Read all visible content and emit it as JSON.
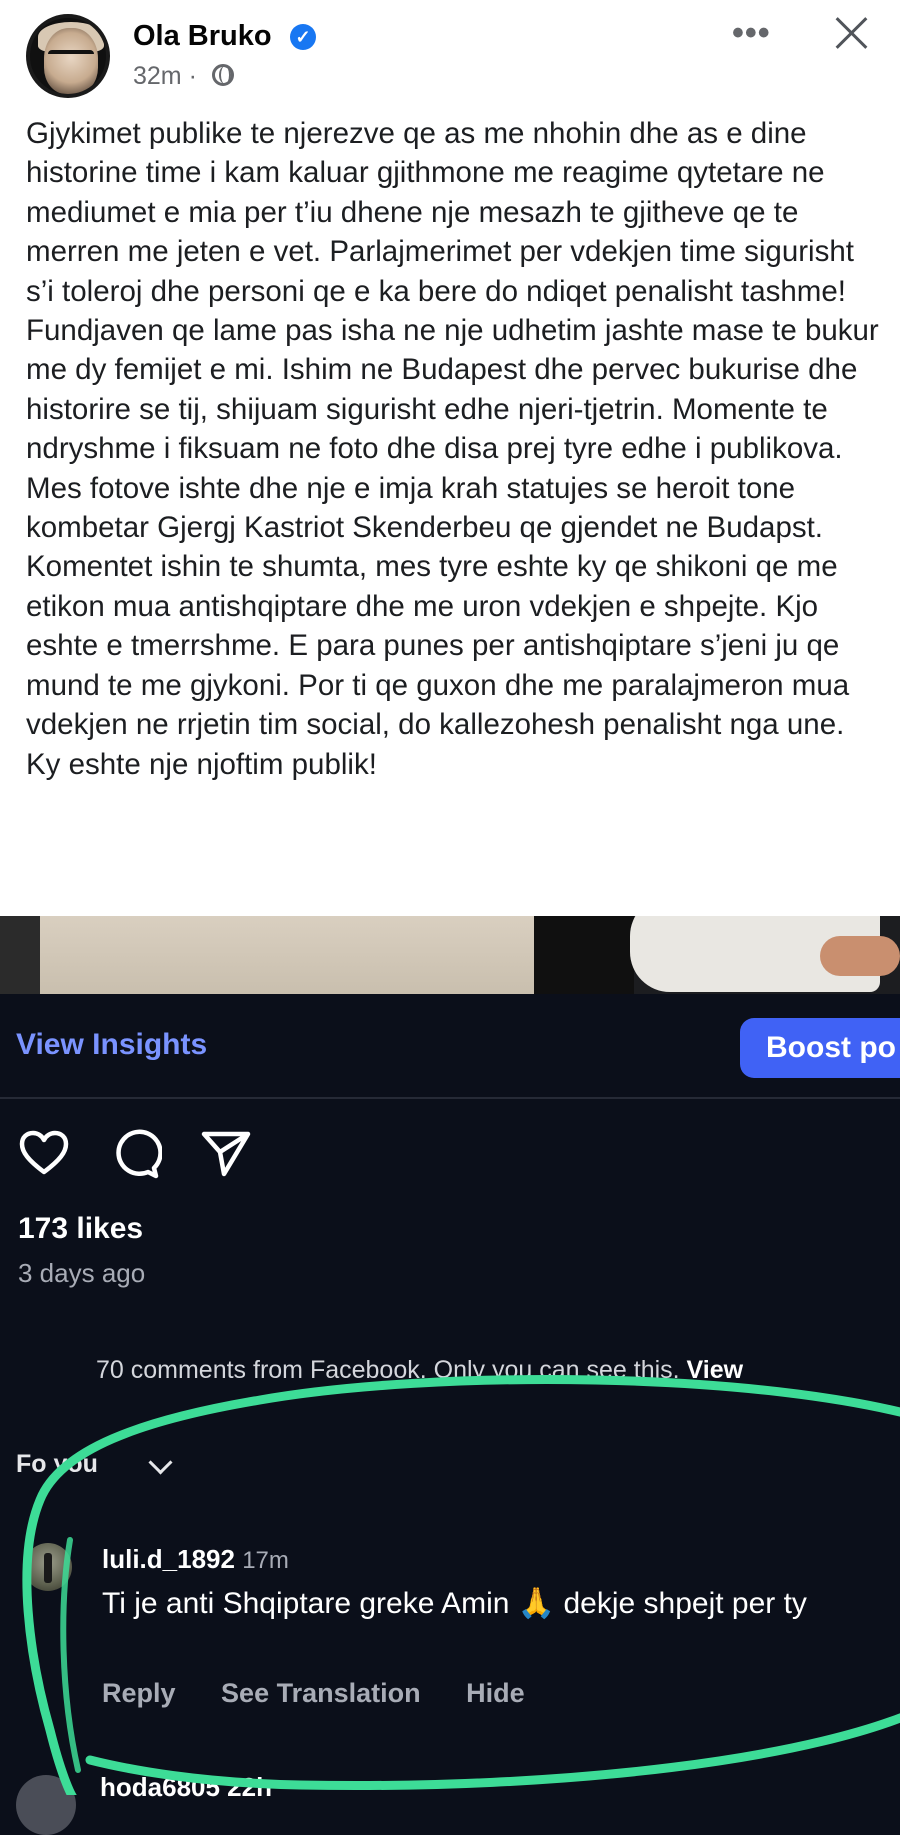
{
  "post": {
    "author": "Ola Bruko",
    "time": "32m ·",
    "text": "Gjykimet publike te njerezve qe as me nhohin dhe as e dine  historine time i kam kaluar gjithmone me reagime qytetare ne mediumet e mia per t’iu dhene nje mesazh te gjitheve qe te merren me jeten e vet. Parlajmerimet per vdekjen time sigurisht s’i toleroj dhe personi qe e ka bere do ndiqet penalisht tashme!\nFundjaven qe lame pas isha ne nje udhetim jashte mase te bukur me dy femijet e mi. Ishim ne Budapest dhe pervec bukurise dhe historire se tij, shijuam sigurisht edhe njeri-tjetrin. Momente te ndryshme i fiksuam ne foto dhe disa prej tyre edhe i publikova. Mes fotove ishte dhe nje e imja krah statujes se heroit tone kombetar Gjergj Kastriot Skenderbeu qe gjendet ne Budapst. Komentet ishin te shumta, mes tyre eshte ky qe shikoni qe me etikon mua antishqiptare dhe me uron vdekjen e shpejte. Kjo eshte e tmerrshme. E para punes per antishqiptare s’jeni ju qe mund te me gjykoni. Por ti qe guxon dhe me paralajmeron mua vdekjen ne rrjetin tim social, do kallezohesh penalisht nga une. Ky eshte nje njoftim publik!",
    "icons": [
      "verified-badge-icon",
      "globe-icon",
      "more-options-icon",
      "close-icon"
    ]
  },
  "instagram": {
    "view_insights": "View Insights",
    "boost": "Boost po",
    "likes": "173 likes",
    "time_ago": "3 days ago",
    "fb_comments_text": "70 comments from Facebook. Only you can see this. ",
    "fb_comments_view": "View",
    "filter": "Fo you",
    "icons": [
      "heart-icon",
      "comment-icon",
      "send-icon",
      "chevron-down-icon"
    ],
    "comment": {
      "username": "luli.d_1892",
      "time": "17m",
      "text": "Ti je anti Shqiptare greke Amin 🙏 dekje shpejt per ty",
      "actions": [
        "Reply",
        "See Translation",
        "Hide"
      ]
    },
    "next_comment_username": "hoda6805 22h"
  },
  "colors": {
    "facebook_blue": "#1877f2",
    "instagram_bg": "#0b0f1a",
    "insights_link": "#7a93ff",
    "boost_button": "#4062f5",
    "highlight_stroke": "#3ddc97"
  }
}
